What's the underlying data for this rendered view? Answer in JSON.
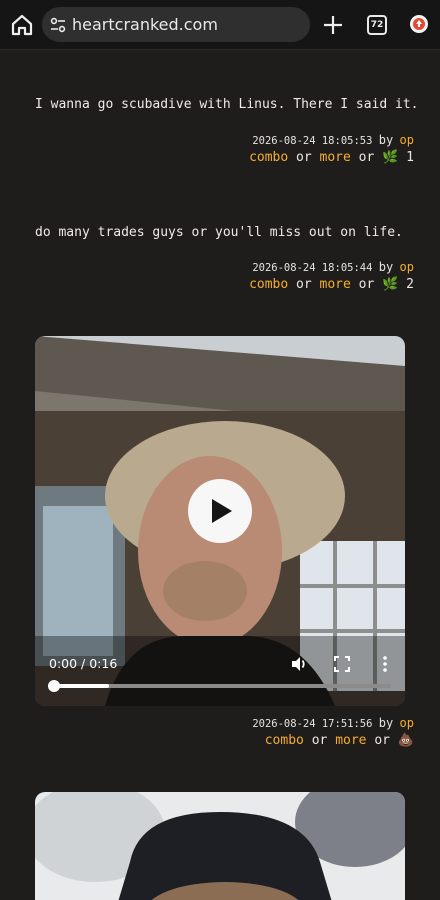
{
  "browser": {
    "url": "heartcranked.com",
    "tab_count": "72",
    "icons": [
      "home-icon",
      "site-settings-icon",
      "new-tab-icon",
      "tab-switcher-icon",
      "update-icon"
    ]
  },
  "posts": [
    {
      "text": "I wanna go scubadive with Linus. There I said it.",
      "timestamp": "2026-08-24 18:05:53",
      "by": "by",
      "author": "op",
      "combo": "combo",
      "or1": "or",
      "more": "more",
      "or2": "or",
      "reaction_emoji": "🌿",
      "reaction_count": "1"
    },
    {
      "text": "do many trades guys or you'll miss out on life.",
      "timestamp": "2026-08-24 18:05:44",
      "by": "by",
      "author": "op",
      "combo": "combo",
      "or1": "or",
      "more": "more",
      "or2": "or",
      "reaction_emoji": "🌿",
      "reaction_count": "2"
    },
    {
      "video": {
        "time": "0:00 / 0:16",
        "progress_fraction": 0.0
      },
      "timestamp": "2026-08-24 17:51:56",
      "by": "by",
      "author": "op",
      "combo": "combo",
      "or1": "or",
      "more": "more",
      "or2": "or",
      "reaction_emoji": "💩"
    }
  ],
  "colors": {
    "background": "#1f1d1c",
    "link": "#f6ad2d",
    "text": "#efeae4",
    "leaf": "#66c238"
  }
}
